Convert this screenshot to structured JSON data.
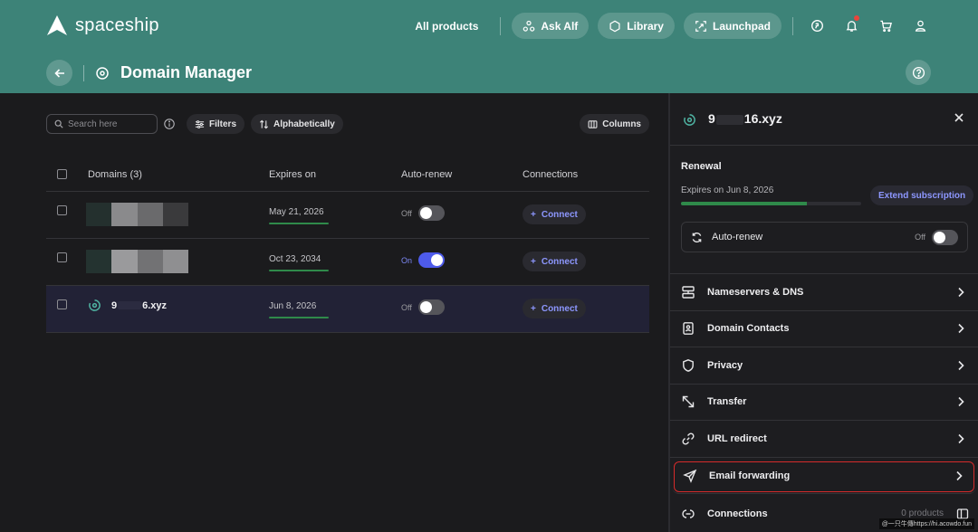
{
  "brand": {
    "name": "spaceship"
  },
  "topnav": {
    "all_products": "All products",
    "ask_alf": "Ask Alf",
    "library": "Library",
    "launchpad": "Launchpad"
  },
  "page": {
    "title": "Domain Manager"
  },
  "toolbar": {
    "search_placeholder": "Search here",
    "filters": "Filters",
    "sort": "Alphabetically",
    "columns": "Columns"
  },
  "table": {
    "headers": {
      "domains": "Domains (3)",
      "expires": "Expires on",
      "autorenew": "Auto-renew",
      "connections": "Connections"
    },
    "rows": [
      {
        "expires": "May 21, 2026",
        "autorenew": "Off",
        "connect": "Connect"
      },
      {
        "expires": "Oct 23, 2034",
        "autorenew": "On",
        "connect": "Connect"
      },
      {
        "name_start": "9",
        "name_end": "6.xyz",
        "expires": "Jun 8, 2026",
        "autorenew": "Off",
        "connect": "Connect"
      }
    ]
  },
  "panel": {
    "title_start": "9",
    "title_end": "16.xyz",
    "renewal_title": "Renewal",
    "expires_text": "Expires on Jun 8, 2026",
    "renewal_progress": 0.7,
    "extend_label": "Extend subscription",
    "autorenew_label": "Auto-renew",
    "autorenew_state": "Off",
    "menu": [
      {
        "label": "Nameservers & DNS"
      },
      {
        "label": "Domain Contacts"
      },
      {
        "label": "Privacy"
      },
      {
        "label": "Transfer"
      },
      {
        "label": "URL redirect"
      },
      {
        "label": "Email forwarding"
      },
      {
        "label": "Connections",
        "meta": "0 products"
      }
    ]
  },
  "watermark": "@一只牛傳https://hi.acowdo.fun",
  "colors": {
    "header": "#3d8378",
    "accent": "#4e5bea",
    "link": "#8d97ff",
    "progress": "#2f8a4a",
    "highlight": "#d62b2b"
  }
}
